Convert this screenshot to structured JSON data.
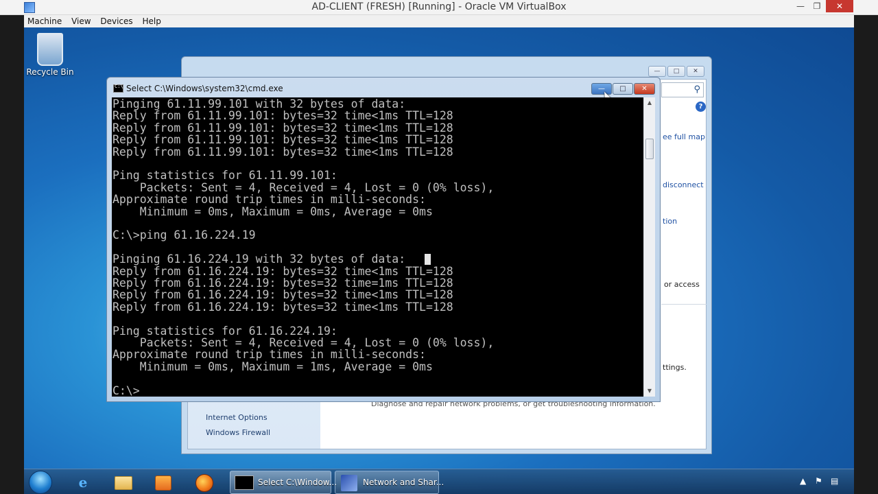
{
  "host": {
    "title": "AD-CLIENT (FRESH) [Running] - Oracle VM VirtualBox",
    "menu": [
      "Machine",
      "View",
      "Devices",
      "Help"
    ]
  },
  "desktop": {
    "icons": [
      {
        "label": "Recycle Bin",
        "icon": "recycle-bin-icon"
      }
    ]
  },
  "explorer": {
    "partial_links": [
      "ee full map",
      "disconnect",
      "tion",
      "ttings."
    ],
    "partial_text": [
      "or access",
      "Diagnose and repair network problems, or get troubleshooting information."
    ],
    "left_links": [
      "Internet Options",
      "Windows Firewall"
    ]
  },
  "cmd": {
    "title": "Select C:\\Windows\\system32\\cmd.exe",
    "lines": [
      "Pinging 61.11.99.101 with 32 bytes of data:",
      "Reply from 61.11.99.101: bytes=32 time<1ms TTL=128",
      "Reply from 61.11.99.101: bytes=32 time<1ms TTL=128",
      "Reply from 61.11.99.101: bytes=32 time<1ms TTL=128",
      "Reply from 61.11.99.101: bytes=32 time<1ms TTL=128",
      "",
      "Ping statistics for 61.11.99.101:",
      "    Packets: Sent = 4, Received = 4, Lost = 0 (0% loss),",
      "Approximate round trip times in milli-seconds:",
      "    Minimum = 0ms, Maximum = 0ms, Average = 0ms",
      "",
      "C:\\>ping 61.16.224.19",
      "",
      "Pinging 61.16.224.19 with 32 bytes of data:",
      "Reply from 61.16.224.19: bytes=32 time<1ms TTL=128",
      "Reply from 61.16.224.19: bytes=32 time=1ms TTL=128",
      "Reply from 61.16.224.19: bytes=32 time<1ms TTL=128",
      "Reply from 61.16.224.19: bytes=32 time<1ms TTL=128",
      "",
      "Ping statistics for 61.16.224.19:",
      "    Packets: Sent = 4, Received = 4, Lost = 0 (0% loss),",
      "Approximate round trip times in milli-seconds:",
      "    Minimum = 0ms, Maximum = 1ms, Average = 0ms",
      "",
      "C:\\>"
    ]
  },
  "taskbar": {
    "pinned": [
      "internet-explorer-icon",
      "windows-explorer-icon",
      "media-player-icon",
      "firefox-icon"
    ],
    "tasks": [
      {
        "label": "Select C:\\Window...",
        "icon": "cmd-icon",
        "active": true
      },
      {
        "label": "Network and Shar...",
        "icon": "network-sharing-icon",
        "active": false
      }
    ]
  }
}
